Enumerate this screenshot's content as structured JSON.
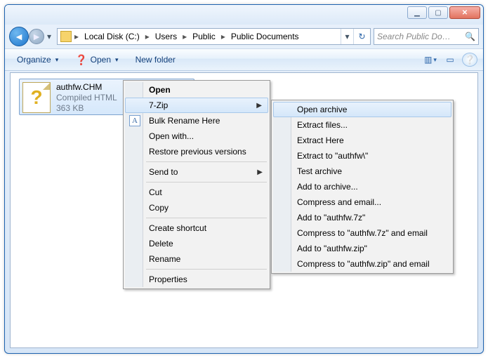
{
  "window": {
    "min_glyph": "▁",
    "max_glyph": "▢",
    "close_glyph": "✕"
  },
  "nav": {
    "back_glyph": "◄",
    "fwd_glyph": "►",
    "dd_glyph": "▾",
    "refresh_glyph": "↻"
  },
  "breadcrumbs": {
    "sep": "▸",
    "a": "Local Disk (C:)",
    "b": "Users",
    "c": "Public",
    "d": "Public Documents"
  },
  "search": {
    "placeholder": "Search Public Do…",
    "icon": "🔍"
  },
  "toolbar": {
    "organize": "Organize",
    "open": "Open",
    "newfolder": "New folder",
    "view_glyph": "▥",
    "view_dd": "▾",
    "preview_glyph": "▭",
    "help_glyph": "❔"
  },
  "file": {
    "name": "authfw.CHM",
    "type": "Compiled HTML",
    "size": "363 KB"
  },
  "menu1": {
    "open": "Open",
    "sevenzip": "7-Zip",
    "bulkrename": "Bulk Rename Here",
    "openwith": "Open with...",
    "restore": "Restore previous versions",
    "sendto": "Send to",
    "cut": "Cut",
    "copy": "Copy",
    "shortcut": "Create shortcut",
    "delete": "Delete",
    "rename": "Rename",
    "properties": "Properties",
    "arrow": "▶",
    "renameicon": "A"
  },
  "menu2": {
    "openarchive": "Open archive",
    "extractfiles": "Extract files...",
    "extracthere": "Extract Here",
    "extractto": "Extract to \"authfw\\\"",
    "testarchive": "Test archive",
    "addarchive": "Add to archive...",
    "compressemail": "Compress and email...",
    "add7z": "Add to \"authfw.7z\"",
    "compress7z": "Compress to \"authfw.7z\" and email",
    "addzip": "Add to \"authfw.zip\"",
    "compresszip": "Compress to \"authfw.zip\" and email"
  }
}
